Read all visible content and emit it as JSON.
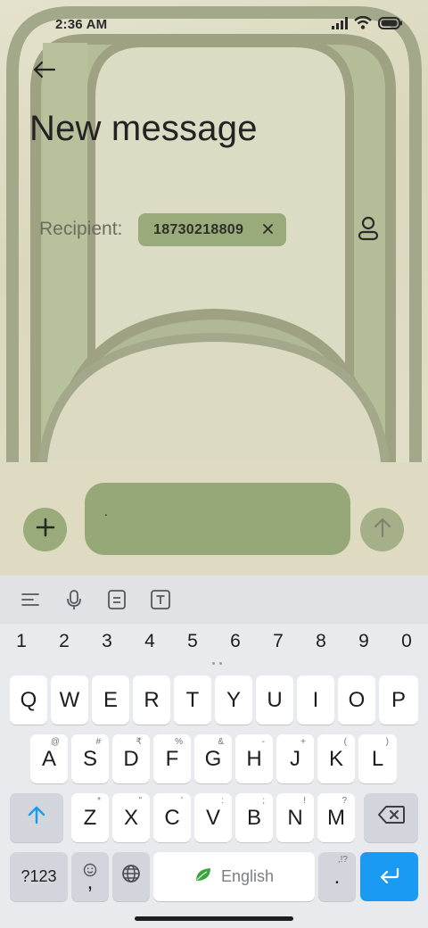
{
  "status_bar": {
    "time": "2:36 AM"
  },
  "header": {
    "title": "New message"
  },
  "recipient": {
    "label": "Recipient:",
    "chip_value": "18730218809"
  },
  "compose": {
    "message_text": "."
  },
  "keyboard": {
    "numbers": [
      "1",
      "2",
      "3",
      "4",
      "5",
      "6",
      "7",
      "8",
      "9",
      "0"
    ],
    "row1": [
      {
        "key": "Q"
      },
      {
        "key": "W"
      },
      {
        "key": "E"
      },
      {
        "key": "R"
      },
      {
        "key": "T"
      },
      {
        "key": "Y"
      },
      {
        "key": "U"
      },
      {
        "key": "I"
      },
      {
        "key": "O"
      },
      {
        "key": "P"
      }
    ],
    "row2": [
      {
        "key": "A",
        "hint": "@"
      },
      {
        "key": "S",
        "hint": "#"
      },
      {
        "key": "D",
        "hint": "₹"
      },
      {
        "key": "F",
        "hint": "%"
      },
      {
        "key": "G",
        "hint": "&"
      },
      {
        "key": "H",
        "hint": "-"
      },
      {
        "key": "J",
        "hint": "+"
      },
      {
        "key": "K",
        "hint": "("
      },
      {
        "key": "L",
        "hint": ")"
      }
    ],
    "row3": [
      {
        "key": "Z",
        "hint": "*"
      },
      {
        "key": "X",
        "hint": "\""
      },
      {
        "key": "C",
        "hint": "'"
      },
      {
        "key": "V",
        "hint": ":"
      },
      {
        "key": "B",
        "hint": ";"
      },
      {
        "key": "N",
        "hint": "!"
      },
      {
        "key": "M",
        "hint": "?"
      }
    ],
    "symbols_label": "?123",
    "comma_label": ",",
    "space_label": "English",
    "period_label": ".",
    "period_hint": ",!?"
  },
  "colors": {
    "accent_green": "#9aab7b",
    "message_box": "#97a878",
    "enter_key": "#1a9bf3",
    "compose_bg": "#dedbc2"
  },
  "icons": {
    "back": "back-arrow-icon",
    "chip_close": "close-icon",
    "contact": "person-icon",
    "add": "plus-icon",
    "send": "arrow-up-icon",
    "toolbar": [
      "menu-lines-icon",
      "microphone-icon",
      "clipboard-icon",
      "text-format-icon"
    ],
    "shift": "shift-arrow-icon",
    "backspace": "backspace-icon",
    "emoji": "emoji-icon",
    "globe": "globe-icon",
    "leaf": "leaf-icon",
    "enter": "enter-icon"
  }
}
